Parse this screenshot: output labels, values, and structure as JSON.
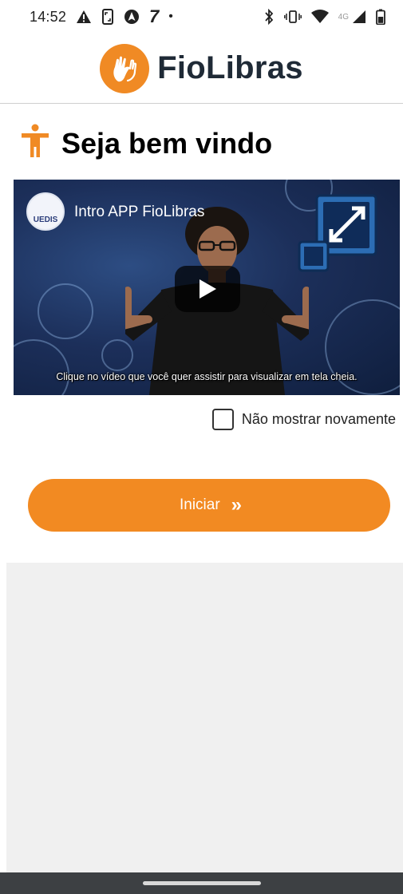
{
  "status_bar": {
    "time": "14:52",
    "seven": "7",
    "dot": "•",
    "network": "4G",
    "icons_left": [
      "warning-icon",
      "screenshot-icon",
      "nav-app-icon",
      "seven-icon",
      "dot-icon"
    ],
    "icons_right": [
      "bluetooth-icon",
      "vibrate-icon",
      "wifi-icon",
      "signal-icon",
      "battery-icon"
    ]
  },
  "header": {
    "app_name": "FioLibras",
    "logo_icon": "sign-language-hands-icon",
    "accent": "#f08a24"
  },
  "welcome": {
    "title": "Seja bem vindo",
    "icon": "accessibility-person-icon"
  },
  "video": {
    "title": "Intro APP FioLibras",
    "channel_badge": "UEDIS",
    "caption": "Clique no vídeo que você quer assistir para visualizar em tela cheia.",
    "play_icon": "play-icon"
  },
  "dont_show": {
    "label": "Não mostrar novamente",
    "checked": false
  },
  "start_button": {
    "label": "Iniciar",
    "chevron": "»",
    "color": "#f28a22"
  },
  "colors": {
    "brand_text": "#1f2a36",
    "gray_area": "#f0f0f0",
    "navbar": "#3d4043"
  }
}
